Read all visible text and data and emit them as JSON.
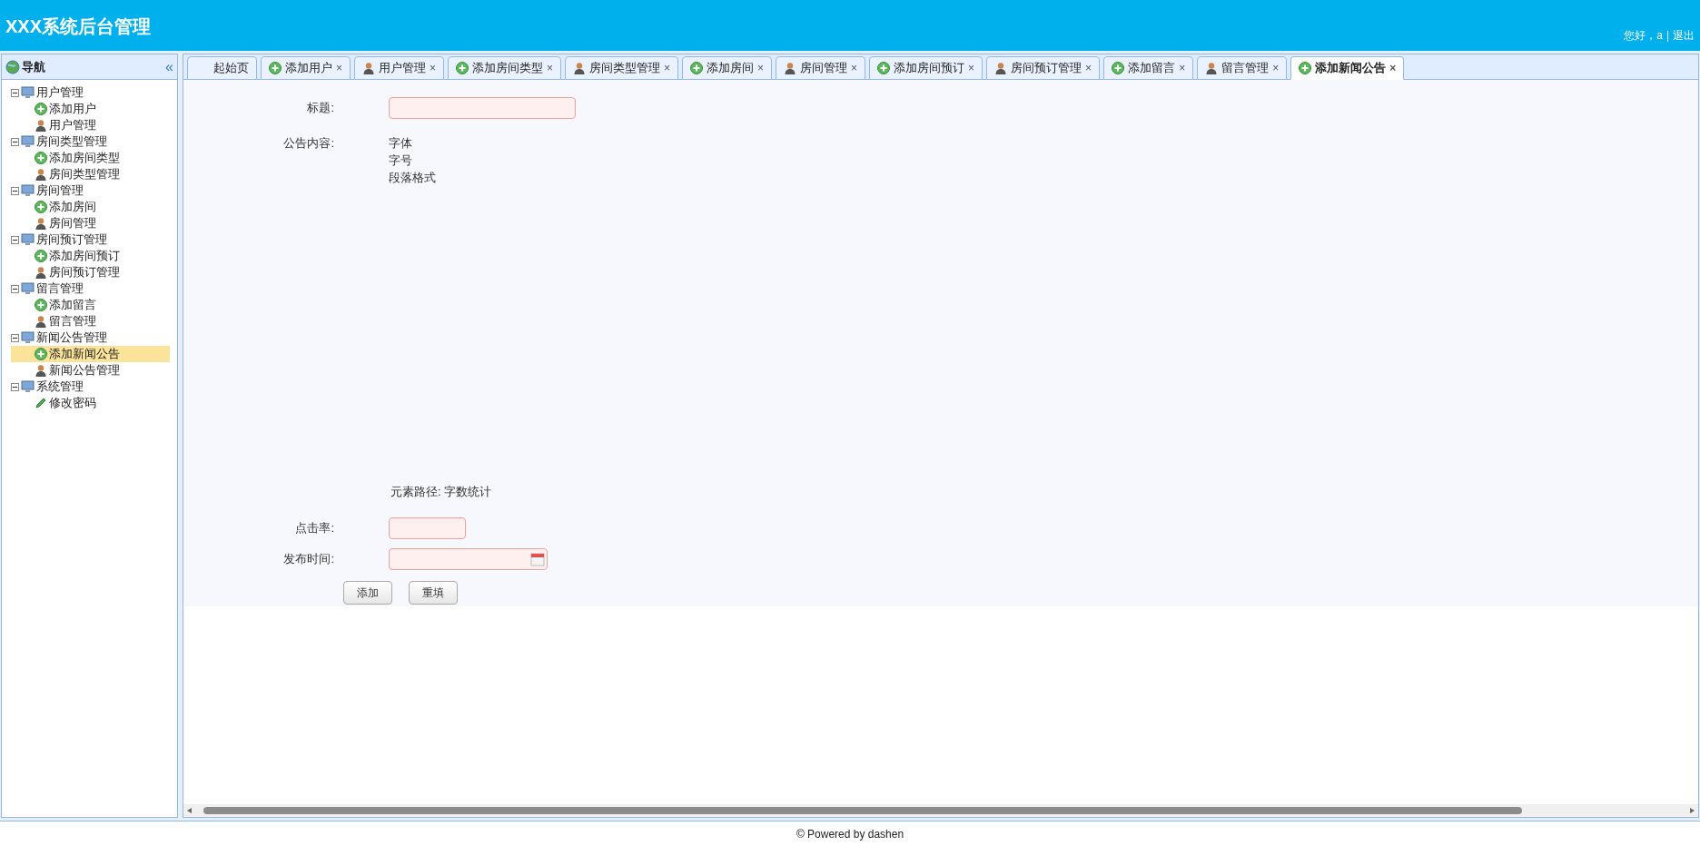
{
  "header": {
    "title": "XXX系统后台管理",
    "greeting": "您好，a",
    "separator": "|",
    "logout": "退出"
  },
  "sidebar": {
    "title": "导航",
    "collapse": "«",
    "tree": [
      {
        "label": "用户管理",
        "expanded": true,
        "children": [
          {
            "label": "添加用户",
            "kind": "add",
            "selected": false
          },
          {
            "label": "用户管理",
            "kind": "user",
            "selected": false
          }
        ]
      },
      {
        "label": "房间类型管理",
        "expanded": true,
        "children": [
          {
            "label": "添加房间类型",
            "kind": "add",
            "selected": false
          },
          {
            "label": "房间类型管理",
            "kind": "user",
            "selected": false
          }
        ]
      },
      {
        "label": "房间管理",
        "expanded": true,
        "children": [
          {
            "label": "添加房间",
            "kind": "add",
            "selected": false
          },
          {
            "label": "房间管理",
            "kind": "user",
            "selected": false
          }
        ]
      },
      {
        "label": "房间预订管理",
        "expanded": true,
        "children": [
          {
            "label": "添加房间预订",
            "kind": "add",
            "selected": false
          },
          {
            "label": "房间预订管理",
            "kind": "user",
            "selected": false
          }
        ]
      },
      {
        "label": "留言管理",
        "expanded": true,
        "children": [
          {
            "label": "添加留言",
            "kind": "add",
            "selected": false
          },
          {
            "label": "留言管理",
            "kind": "user",
            "selected": false
          }
        ]
      },
      {
        "label": "新闻公告管理",
        "expanded": true,
        "children": [
          {
            "label": "添加新闻公告",
            "kind": "add",
            "selected": true
          },
          {
            "label": "新闻公告管理",
            "kind": "user",
            "selected": false
          }
        ]
      },
      {
        "label": "系统管理",
        "expanded": true,
        "children": [
          {
            "label": "修改密码",
            "kind": "pencil",
            "selected": false
          }
        ]
      }
    ]
  },
  "tabs": [
    {
      "label": "起始页",
      "kind": "plain",
      "selected": false,
      "closable": false
    },
    {
      "label": "添加用户",
      "kind": "add",
      "selected": false,
      "closable": true
    },
    {
      "label": "用户管理",
      "kind": "user",
      "selected": false,
      "closable": true
    },
    {
      "label": "添加房间类型",
      "kind": "add",
      "selected": false,
      "closable": true
    },
    {
      "label": "房间类型管理",
      "kind": "user",
      "selected": false,
      "closable": true
    },
    {
      "label": "添加房间",
      "kind": "add",
      "selected": false,
      "closable": true
    },
    {
      "label": "房间管理",
      "kind": "user",
      "selected": false,
      "closable": true
    },
    {
      "label": "添加房间预订",
      "kind": "add",
      "selected": false,
      "closable": true
    },
    {
      "label": "房间预订管理",
      "kind": "user",
      "selected": false,
      "closable": true
    },
    {
      "label": "添加留言",
      "kind": "add",
      "selected": false,
      "closable": true
    },
    {
      "label": "留言管理",
      "kind": "user",
      "selected": false,
      "closable": true
    },
    {
      "label": "添加新闻公告",
      "kind": "add",
      "selected": true,
      "closable": true
    }
  ],
  "close_mark": "×",
  "form": {
    "title_label": "标题:",
    "content_label": "公告内容:",
    "editor_menus": [
      "字体",
      "字号",
      "段落格式"
    ],
    "editor_status": "元素路径: 字数统计",
    "clicks_label": "点击率:",
    "date_label": "发布时间:",
    "buttons": [
      "添加",
      "重填"
    ]
  },
  "footer": "© Powered by dashen"
}
